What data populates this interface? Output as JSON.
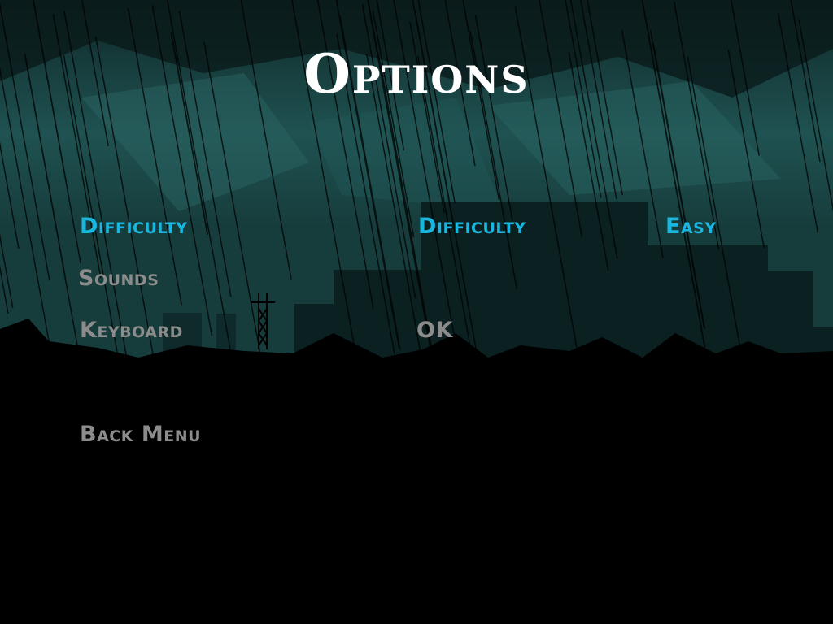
{
  "title": "Options",
  "menu": {
    "items": [
      {
        "label": "Difficulty",
        "state": "selected"
      },
      {
        "label": "Sounds",
        "state": "normal"
      },
      {
        "label": "Keyboard",
        "state": "normal"
      },
      {
        "label": "Back Menu",
        "state": "normal"
      }
    ]
  },
  "detail": {
    "setting_label": "Difficulty",
    "setting_value": "Easy",
    "confirm_label": "OK"
  },
  "colors": {
    "selected": "#19b6e0",
    "normal": "#8c8c8c",
    "title": "#ffffff",
    "sky": "#1c4a48"
  }
}
